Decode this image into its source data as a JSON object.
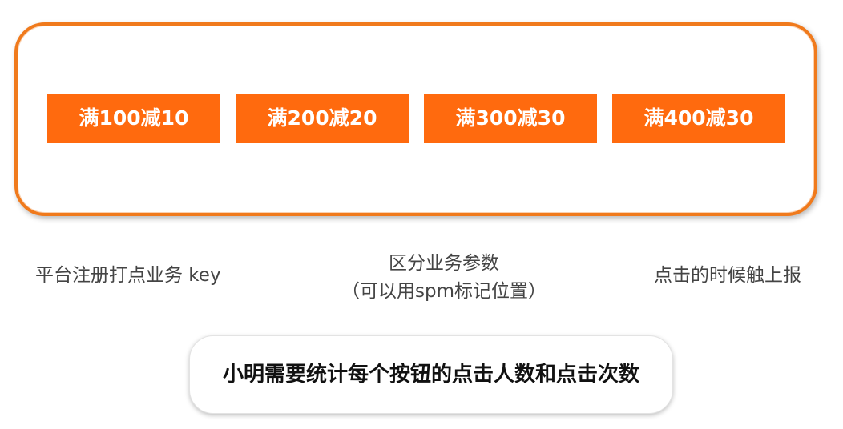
{
  "coupons": [
    {
      "label": "满100减10"
    },
    {
      "label": "满200减20"
    },
    {
      "label": "满300减30"
    },
    {
      "label": "满400减30"
    }
  ],
  "labels": {
    "left": "平台注册打点业务 key",
    "middle_line1": "区分业务参数",
    "middle_line2": "（可以用spm标记位置）",
    "right": "点击的时候触上报"
  },
  "goal": "小明需要统计每个按钮的点击人数和点击次数",
  "colors": {
    "accent": "#ff6a0e",
    "frame_border": "#f07a1c"
  }
}
